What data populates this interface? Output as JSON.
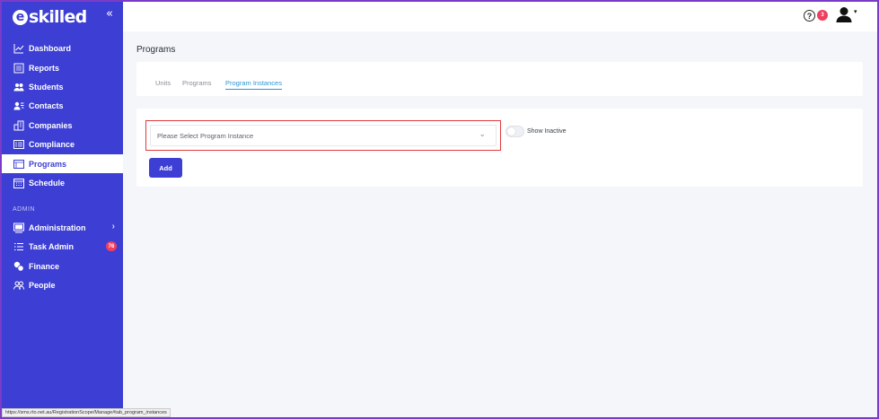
{
  "brand": {
    "logo_letter": "e",
    "logo_text": "skilled",
    "collapse_glyph": "«"
  },
  "sidebar": {
    "items": [
      {
        "label": "Dashboard",
        "icon": "chart-line-icon"
      },
      {
        "label": "Reports",
        "icon": "report-icon"
      },
      {
        "label": "Students",
        "icon": "students-icon"
      },
      {
        "label": "Contacts",
        "icon": "contacts-icon"
      },
      {
        "label": "Companies",
        "icon": "companies-icon"
      },
      {
        "label": "Compliance",
        "icon": "compliance-icon"
      },
      {
        "label": "Programs",
        "icon": "programs-icon",
        "active": true
      },
      {
        "label": "Schedule",
        "icon": "calendar-icon"
      }
    ],
    "admin_section_label": "ADMIN",
    "admin_items": [
      {
        "label": "Administration",
        "icon": "monitor-icon",
        "chevron": "›"
      },
      {
        "label": "Task Admin",
        "icon": "task-list-icon",
        "badge": "76"
      },
      {
        "label": "Finance",
        "icon": "coins-icon"
      },
      {
        "label": "People",
        "icon": "people-icon"
      }
    ]
  },
  "topbar": {
    "help_glyph": "?",
    "help_badge": "3",
    "user_caret": "▾"
  },
  "main": {
    "page_title": "Programs",
    "tabs": [
      {
        "label": "Units"
      },
      {
        "label": "Programs"
      },
      {
        "label": "Program Instances",
        "active": true
      }
    ],
    "select": {
      "placeholder": "Please Select Program Instance",
      "chevron": "⌄"
    },
    "toggle": {
      "label": "Show Inactive",
      "on": false
    },
    "add_button_label": "Add"
  },
  "statusbar": {
    "url": "https://sms.rto.net.au/RegistrationScope/Manage#tab_program_instances"
  },
  "colors": {
    "sidebar": "#3c3ed4",
    "accent": "#3c3ed4",
    "tab_active": "#2b96d6",
    "badge": "#ee3f5f",
    "highlight": "#e23a3a"
  }
}
